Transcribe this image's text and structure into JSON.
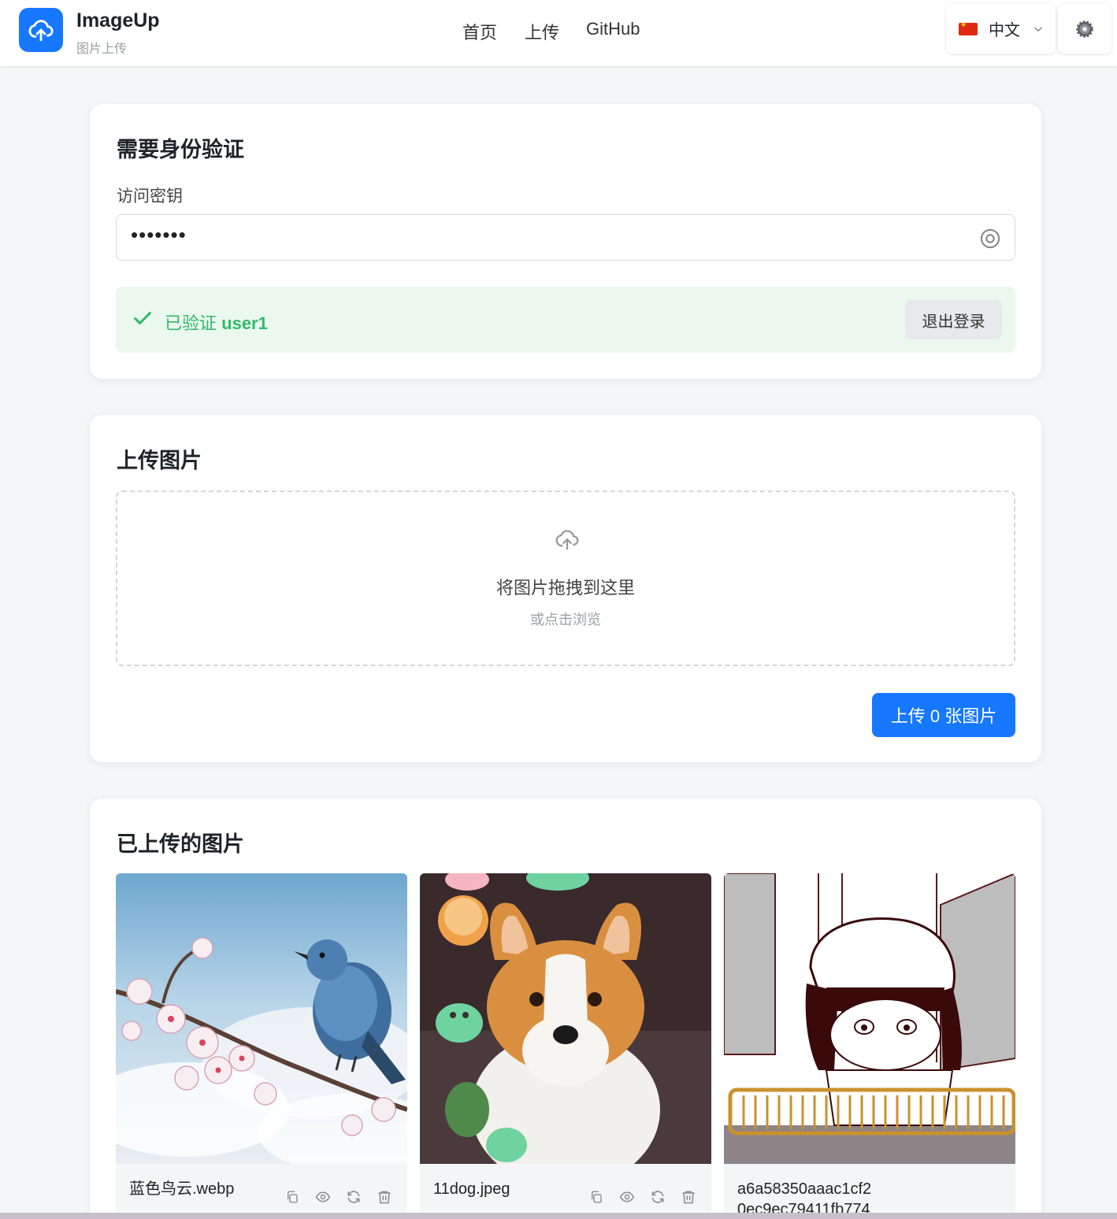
{
  "header": {
    "title": "ImageUp",
    "subtitle": "图片上传",
    "nav": [
      "首页",
      "上传",
      "GitHub"
    ],
    "language": "中文",
    "brand_color": "#1677ff"
  },
  "auth": {
    "title": "需要身份验证",
    "label": "访问密钥",
    "password_mask": "•••••••",
    "verified_prefix": "已验证",
    "verified_user": "user1",
    "logout_label": "退出登录"
  },
  "upload": {
    "title": "上传图片",
    "drop_text": "将图片拖拽到这里",
    "browse_text": "或点击浏览",
    "button_label": "上传 0 张图片"
  },
  "gallery": {
    "title": "已上传的图片",
    "images": [
      {
        "name": "蓝色鸟云.webp"
      },
      {
        "name": "11dog.jpeg"
      },
      {
        "name": "a6a58350aaac1cf20ec9ec79411fb774"
      }
    ]
  }
}
